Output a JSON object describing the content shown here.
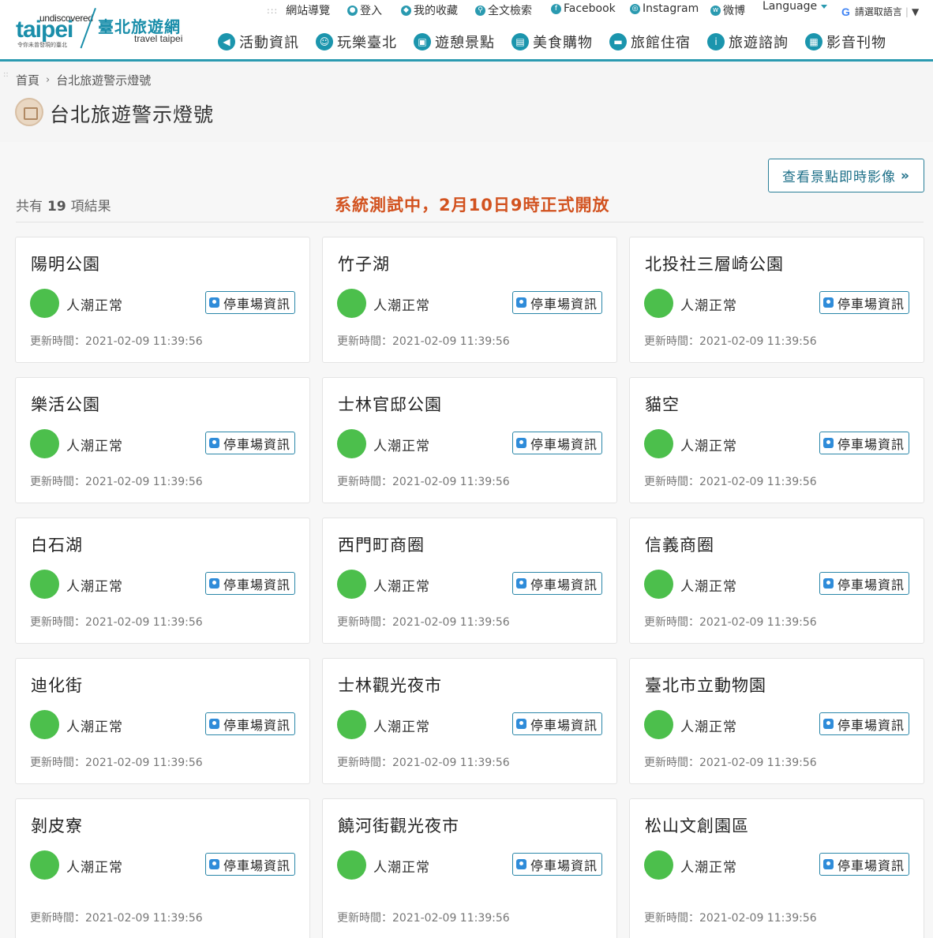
{
  "header": {
    "logo_brand": "taipei",
    "logo_undiscovered": "undiscovered",
    "logo_tagline": "令你未曾發現的臺北",
    "logo_cn": "臺北旅遊網",
    "logo_en": "travel taipei",
    "util_links": [
      {
        "label": "網站導覽",
        "icon": "sitemap-dots-icon"
      },
      {
        "label": "登入",
        "icon": "user-icon"
      },
      {
        "label": "我的收藏",
        "icon": "gem-icon"
      },
      {
        "label": "全文檢索",
        "icon": "search-icon"
      },
      {
        "label": "Facebook",
        "icon": "facebook-icon"
      },
      {
        "label": "Instagram",
        "icon": "instagram-icon"
      },
      {
        "label": "微博",
        "icon": "weibo-icon"
      }
    ],
    "language_label": "Language",
    "translate_label": "請選取語言",
    "nav": [
      {
        "label": "活動資訊",
        "icon": "megaphone-icon"
      },
      {
        "label": "玩樂臺北",
        "icon": "smile-icon"
      },
      {
        "label": "遊憩景點",
        "icon": "image-icon"
      },
      {
        "label": "美食購物",
        "icon": "bag-icon"
      },
      {
        "label": "旅館住宿",
        "icon": "bed-icon"
      },
      {
        "label": "旅遊諮詢",
        "icon": "info-person-icon"
      },
      {
        "label": "影音刊物",
        "icon": "film-icon"
      }
    ]
  },
  "breadcrumb": {
    "home": "首頁",
    "current": "台北旅遊警示燈號"
  },
  "page_title": "台北旅遊警示燈號",
  "live_button_label": "查看景點即時影像",
  "result_count": {
    "prefix": "共有",
    "count": "19",
    "suffix": "項結果"
  },
  "notice": "系統測試中，2月10日9時正式開放",
  "status_color": "#4cbf4c",
  "accent_color": "#2a9ab0",
  "notice_color": "#d2521f",
  "labels": {
    "parking": "停車場資訊",
    "updated_prefix": "更新時間：",
    "crowd_normal": "人潮正常"
  },
  "spots": [
    {
      "name": "陽明公園",
      "status": "人潮正常",
      "updated": "2021-02-09 11:39:56"
    },
    {
      "name": "竹子湖",
      "status": "人潮正常",
      "updated": "2021-02-09 11:39:56"
    },
    {
      "name": "北投社三層崎公園",
      "status": "人潮正常",
      "updated": "2021-02-09 11:39:56"
    },
    {
      "name": "樂活公園",
      "status": "人潮正常",
      "updated": "2021-02-09 11:39:56"
    },
    {
      "name": "士林官邸公園",
      "status": "人潮正常",
      "updated": "2021-02-09 11:39:56"
    },
    {
      "name": "貓空",
      "status": "人潮正常",
      "updated": "2021-02-09 11:39:56"
    },
    {
      "name": "白石湖",
      "status": "人潮正常",
      "updated": "2021-02-09 11:39:56"
    },
    {
      "name": "西門町商圈",
      "status": "人潮正常",
      "updated": "2021-02-09 11:39:56"
    },
    {
      "name": "信義商圈",
      "status": "人潮正常",
      "updated": "2021-02-09 11:39:56"
    },
    {
      "name": "迪化街",
      "status": "人潮正常",
      "updated": "2021-02-09 11:39:56"
    },
    {
      "name": "士林觀光夜市",
      "status": "人潮正常",
      "updated": "2021-02-09 11:39:56"
    },
    {
      "name": "臺北市立動物園",
      "status": "人潮正常",
      "updated": "2021-02-09 11:39:56"
    },
    {
      "name": "剝皮寮",
      "status": "人潮正常",
      "updated": "2021-02-09 11:39:56"
    },
    {
      "name": "饒河街觀光夜市",
      "status": "人潮正常",
      "updated": "2021-02-09 11:39:56"
    },
    {
      "name": "松山文創園區",
      "status": "人潮正常",
      "updated": "2021-02-09 11:39:56"
    }
  ]
}
